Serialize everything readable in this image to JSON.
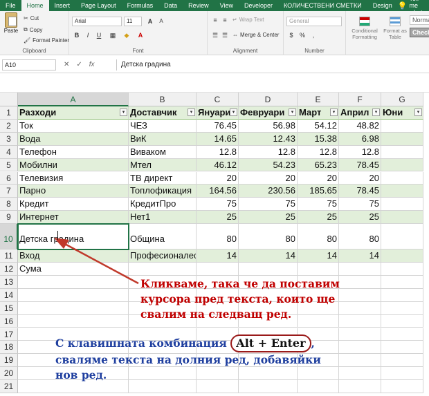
{
  "ribbon_tabs": [
    "File",
    "Home",
    "Insert",
    "Page Layout",
    "Formulas",
    "Data",
    "Review",
    "View",
    "Developer",
    "КОЛИЧЕСТВЕНИ СМЕТКИ",
    "Design"
  ],
  "tell_me": "Tell me what",
  "clipboard": {
    "paste": "Paste",
    "cut": "Cut",
    "copy": "Copy",
    "format_painter": "Format Painter",
    "label": "Clipboard"
  },
  "font": {
    "name": "Arial",
    "size": "11",
    "bold": "B",
    "italic": "I",
    "underline": "U",
    "label": "Font"
  },
  "alignment": {
    "wrap": "Wrap Text",
    "merge": "Merge & Center",
    "label": "Alignment"
  },
  "number": {
    "format": "General",
    "percent": "%",
    "comma": ",",
    "label": "Number"
  },
  "styles": {
    "conditional": "Conditional Formatting",
    "format_table": "Format as Table",
    "normal": "Norma",
    "check": "Check"
  },
  "formula_bar": {
    "name_box": "A10",
    "cancel": "✕",
    "enter": "✓",
    "fx": "fx",
    "content": "Детска градина"
  },
  "columns": [
    "A",
    "B",
    "C",
    "D",
    "E",
    "F",
    "G"
  ],
  "selected_column": "A",
  "selected_row": "10",
  "header_row": {
    "num": "1",
    "cells": [
      "Разходи",
      "Доставчик",
      "Януари",
      "Февруари",
      "Март",
      "Април",
      "Юни"
    ]
  },
  "rows": [
    {
      "num": "2",
      "a": "Ток",
      "b": "ЧЕЗ",
      "c": "76.45",
      "d": "56.98",
      "e": "54.12",
      "f": "48.82"
    },
    {
      "num": "3",
      "a": "Вода",
      "b": "ВиК",
      "c": "14.65",
      "d": "12.43",
      "e": "15.38",
      "f": "6.98"
    },
    {
      "num": "4",
      "a": "Телефон",
      "b": "Виваком",
      "c": "12.8",
      "d": "12.8",
      "e": "12.8",
      "f": "12.8"
    },
    {
      "num": "5",
      "a": "Мобилни",
      "b": "Мтел",
      "c": "46.12",
      "d": "54.23",
      "e": "65.23",
      "f": "78.45"
    },
    {
      "num": "6",
      "a": "Телевизия",
      "b": "ТВ директ",
      "c": "20",
      "d": "20",
      "e": "20",
      "f": "20"
    },
    {
      "num": "7",
      "a": "Парно",
      "b": "Топлофикация",
      "c": "164.56",
      "d": "230.56",
      "e": "185.65",
      "f": "78.45"
    },
    {
      "num": "8",
      "a": "Кредит",
      "b": "КредитПро",
      "c": "75",
      "d": "75",
      "e": "75",
      "f": "75"
    },
    {
      "num": "9",
      "a": "Интернет",
      "b": "Нет1",
      "c": "25",
      "d": "25",
      "e": "25",
      "f": "25"
    },
    {
      "num": "10",
      "a": "Детска градина",
      "b": "Община",
      "c": "80",
      "d": "80",
      "e": "80",
      "f": "80"
    },
    {
      "num": "11",
      "a": "Вход",
      "b": "Професионалест",
      "c": "14",
      "d": "14",
      "e": "14",
      "f": "14"
    },
    {
      "num": "12",
      "a": "Сума",
      "b": "",
      "c": "",
      "d": "",
      "e": "",
      "f": ""
    }
  ],
  "empty_rows": [
    "13",
    "14",
    "15",
    "16",
    "17",
    "18",
    "19",
    "20",
    "21"
  ],
  "annotation_red": [
    "Кликваме, така че да поставим",
    "курсора пред текста, които ще",
    "свалим на следващ ред."
  ],
  "annotation_blue": {
    "line1_before": "С клавишната комбинация",
    "shortcut": "Alt + Enter",
    "line1_after": ",",
    "line2": "сваляме текста на долния ред, добавяйки",
    "line3": "нов ред."
  },
  "colors": {
    "excel_green": "#217346",
    "band": "#e2efda",
    "annotation_red": "#c00000",
    "annotation_blue": "#1f3f9f",
    "arrow": "#c0392b"
  }
}
